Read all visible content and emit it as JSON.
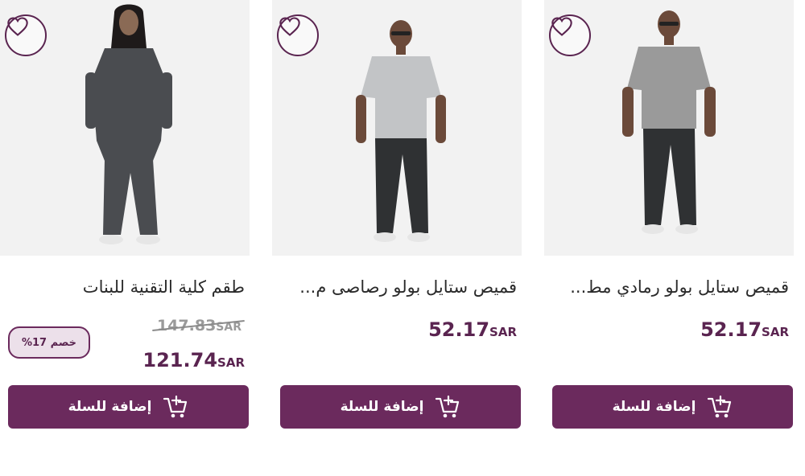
{
  "products": [
    {
      "title": "قميص ستايل بولو رمادي مط...",
      "price": "52.17",
      "currency": "SAR",
      "add_to_cart_label": "إضافة للسلة",
      "favorite_icon": "heart-outline-icon",
      "cart_icon": "cart-plus-icon"
    },
    {
      "title": "قميص ستايل بولو رصاصى م...",
      "price": "52.17",
      "currency": "SAR",
      "add_to_cart_label": "إضافة للسلة",
      "favorite_icon": "heart-outline-icon",
      "cart_icon": "cart-plus-icon"
    },
    {
      "title": "طقم كلية التقنية للبنات",
      "price": "121.74",
      "old_price": "147.83",
      "currency": "SAR",
      "discount_badge": "خصم 17%",
      "add_to_cart_label": "إضافة للسلة",
      "favorite_icon": "heart-outline-icon",
      "cart_icon": "cart-plus-icon"
    }
  ],
  "colors": {
    "brand": "#6b2a5d",
    "price": "#5a2450",
    "badge_bg": "#ece0ea",
    "image_bg": "#f2f2f2"
  }
}
